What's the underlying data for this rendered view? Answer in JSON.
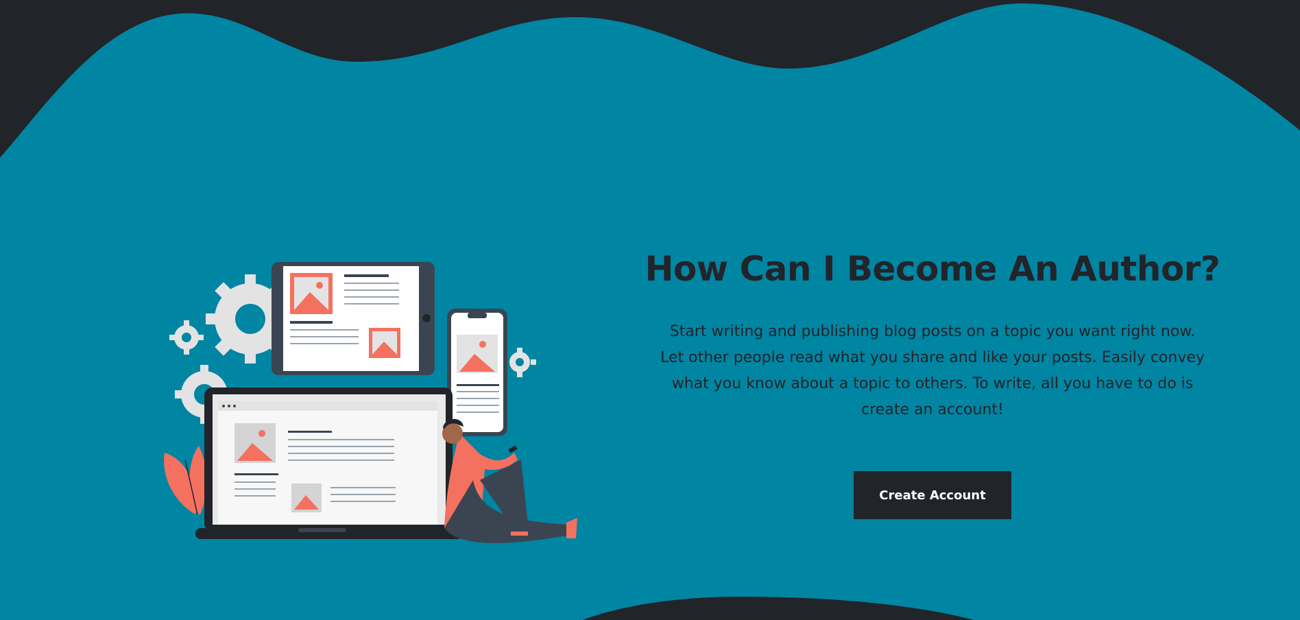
{
  "colors": {
    "background": "#212429",
    "accent": "#0085A3",
    "illustration_coral": "#F4705F",
    "illustration_gray": "#E5E5E5",
    "device_dark": "#3A4551"
  },
  "hero": {
    "title": "How Can I Become An Author?",
    "description": "Start writing and publishing blog posts on a topic you want right now. Let other people read what you share and like your posts. Easily convey what you know about a topic to others. To write, all you have to do is create an account!",
    "cta_label": "Create Account"
  },
  "illustration": {
    "subject": "person-with-devices-illustration"
  }
}
